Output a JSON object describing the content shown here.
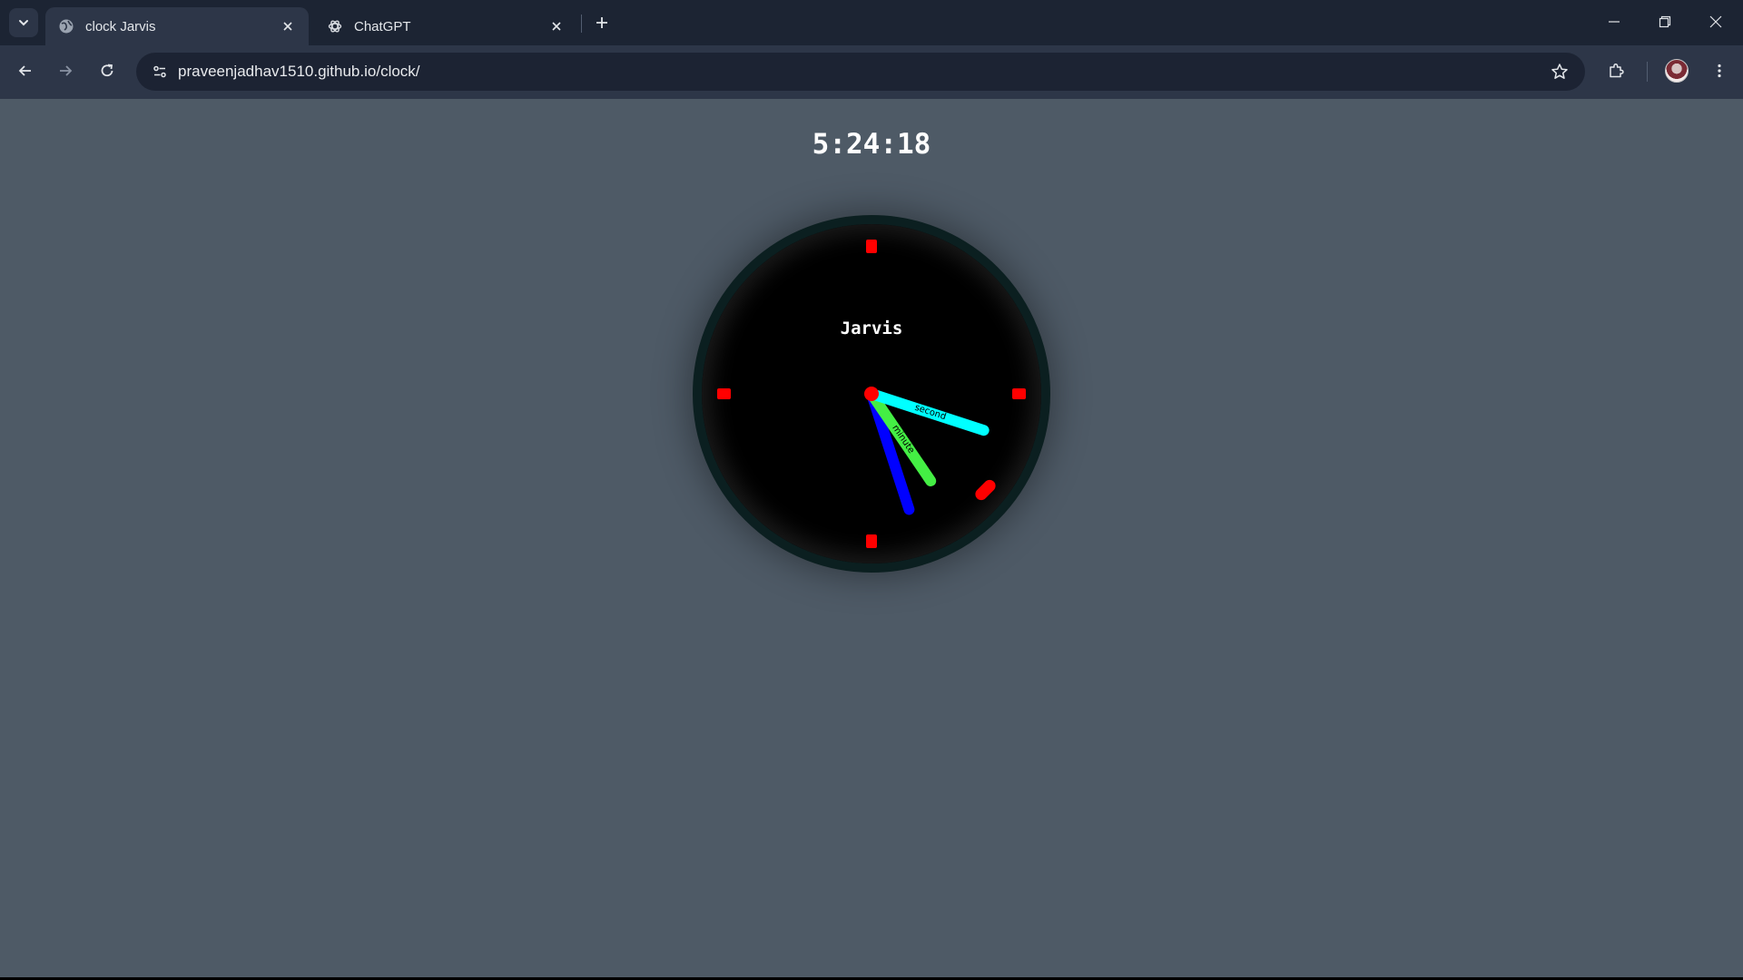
{
  "browser": {
    "tabs": [
      {
        "title": "clock Jarvis",
        "favicon": "globe-icon",
        "active": true
      },
      {
        "title": "ChatGPT",
        "favicon": "chatgpt-logo-icon",
        "active": false
      }
    ],
    "url": "praveenjadhav1510.github.io/clock/"
  },
  "page": {
    "digital_time": "5:24:18",
    "clock_label": "Jarvis",
    "hands": {
      "hour": {
        "label": "",
        "color": "#0000ff"
      },
      "minute": {
        "label": "minute",
        "color": "#44ee44"
      },
      "second": {
        "label": "second",
        "color": "#00ffff"
      }
    },
    "time": {
      "hours": 5,
      "minutes": 24,
      "seconds": 18
    },
    "colors": {
      "page_bg": "#4e5a66",
      "clock_face": "#000000",
      "clock_rim": "#0b1f20",
      "markers": "#ff0000",
      "chrome_bg": "#1c2433",
      "toolbar_bg": "#2d3648"
    }
  }
}
